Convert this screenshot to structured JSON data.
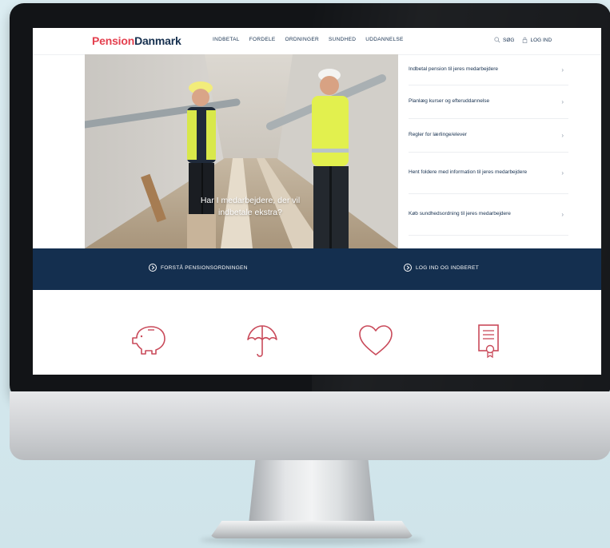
{
  "brand": {
    "part1": "Pension",
    "part2": "Danmark",
    "accent": "#e4404f",
    "navy": "#16304f"
  },
  "nav": {
    "items": [
      "INDBETAL",
      "FORDELE",
      "ORDNINGER",
      "SUNDHED",
      "UDDANNELSE"
    ]
  },
  "utility": {
    "search_label": "SØG",
    "login_label": "LOG IND"
  },
  "hero": {
    "caption_line1": "Har I medarbejdere, der vil",
    "caption_line2": "indbetale ekstra?"
  },
  "side_links": [
    "Indbetal pension til jeres medarbejdere",
    "Planlæg kurser og efteruddannelse",
    "Regler for lærlinge/elever",
    "Hent foldere med information til jeres medarbejdere",
    "Køb sundhedsordning til jeres medarbejdere"
  ],
  "band": {
    "left_cta": "FORSTÅ PENSIONSORDNINGEN",
    "right_cta": "LOG IND OG INDBERET",
    "color": "#142f4f"
  },
  "feature_icons": [
    "piggy-bank-icon",
    "umbrella-icon",
    "heart-icon",
    "certificate-icon"
  ]
}
